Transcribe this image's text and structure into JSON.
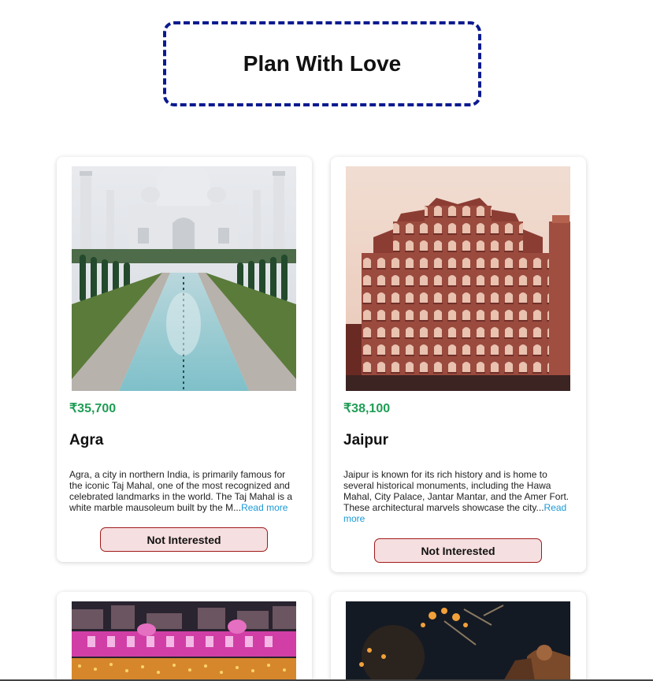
{
  "header": {
    "title": "Plan With Love"
  },
  "tours": [
    {
      "price": "₹35,700",
      "name": "Agra",
      "description": "Agra, a city in northern India, is primarily famous for the iconic Taj Mahal, one of the most recognized and celebrated landmarks in the world. The Taj Mahal is a white marble mausoleum built by the M...",
      "read_more": "Read more",
      "button": "Not Interested"
    },
    {
      "price": "₹38,100",
      "name": "Jaipur",
      "description": "Jaipur is known for its rich history and is home to several historical monuments, including the Hawa Mahal, City Palace, Jantar Mantar, and the Amer Fort. These architectural marvels showcase the city...",
      "read_more": "Read more",
      "button": "Not Interested"
    }
  ],
  "colors": {
    "price": "#1f9d55",
    "link": "#1a9ad6",
    "button_bg": "#f6dfe0",
    "button_border": "#a11a1a",
    "title_border": "#0b1a8f"
  }
}
